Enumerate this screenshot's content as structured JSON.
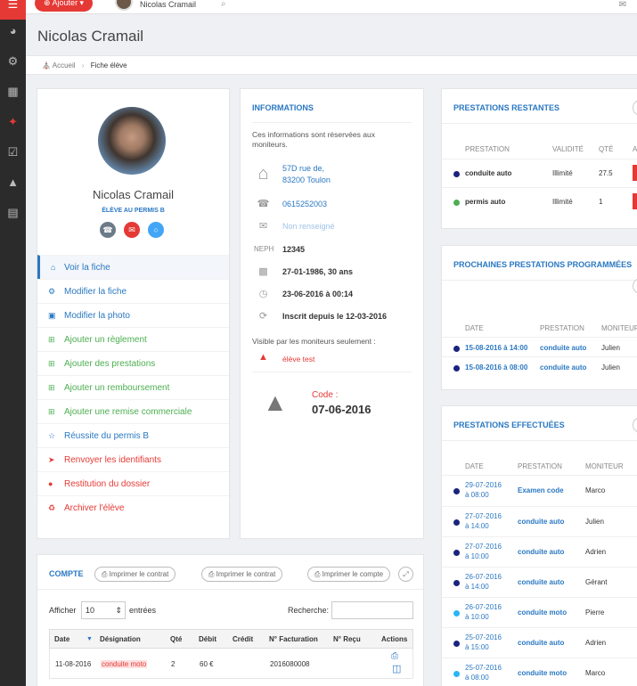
{
  "sidebar": {
    "icons": [
      "menu-icon",
      "dashboard-icon",
      "cogs-icon",
      "calendar-icon",
      "student-icon",
      "checklist-icon",
      "graduation-icon",
      "list-icon"
    ]
  },
  "topbar": {
    "add_label": "⊕ Ajouter ▾",
    "user_name": "Nicolas Cramail",
    "search_icon": "⌕",
    "mail_icon": "✉"
  },
  "page": {
    "title": "Nicolas Cramail"
  },
  "breadcrumb": {
    "home": "Accueil",
    "current": "Fiche élève",
    "sep": "›"
  },
  "profile": {
    "name": "Nicolas Cramail",
    "subtitle": "ÉLÈVE AU PERMIS B",
    "actions": [
      "phone",
      "mail",
      "chat"
    ]
  },
  "menu": [
    {
      "label": "Voir la fiche",
      "icon": "⌂",
      "color": "blue"
    },
    {
      "label": "Modifier la fiche",
      "icon": "⚙",
      "color": "blue"
    },
    {
      "label": "Modifier la photo",
      "icon": "▣",
      "color": "blue"
    },
    {
      "label": "Ajouter un règlement",
      "icon": "⊞",
      "color": "green"
    },
    {
      "label": "Ajouter des prestations",
      "icon": "⊞",
      "color": "green"
    },
    {
      "label": "Ajouter un remboursement",
      "icon": "⊞",
      "color": "green"
    },
    {
      "label": "Ajouter une remise commerciale",
      "icon": "⊞",
      "color": "green"
    },
    {
      "label": "Réussite du permis B",
      "icon": "☆",
      "color": "blue"
    },
    {
      "label": "Renvoyer les identifiants",
      "icon": "➤",
      "color": "red"
    },
    {
      "label": "Restitution du dossier",
      "icon": "●",
      "color": "red"
    },
    {
      "label": "Archiver l'élève",
      "icon": "♻",
      "color": "red"
    }
  ],
  "informations": {
    "title": "INFORMATIONS",
    "notice": "Ces informations sont réservées aux moniteurs.",
    "address_line1": "57D rue de,",
    "address_line2": "83200 Toulon",
    "phone": "0615252003",
    "email": "Non renseigné",
    "neph_label": "NEPH",
    "neph": "12345",
    "birth": "27-01-1986, 30 ans",
    "created": "23-06-2016 à 00:14",
    "registered": "Inscrit depuis le 12-03-2016",
    "visible_label": "Visible par les moniteurs seulement :",
    "alert": "élève test",
    "code_label": "Code :",
    "code_date": "07-06-2016"
  },
  "restantes": {
    "title": "PRESTATIONS RESTANTES",
    "headers": [
      "PRESTATION",
      "VALIDITÉ",
      "QTÉ",
      "A"
    ],
    "rows": [
      {
        "name": "conduite auto",
        "validity": "Illimité",
        "qty": "27.5",
        "color": "#1a237e"
      },
      {
        "name": "permis auto",
        "validity": "Illimité",
        "qty": "1",
        "color": "#4caf50"
      }
    ]
  },
  "prochaines": {
    "title": "PROCHAINES PRESTATIONS PROGRAMMÉES",
    "headers": [
      "DATE",
      "PRESTATION",
      "MONITEUR"
    ],
    "rows": [
      {
        "date": "15-08-2016 à 14:00",
        "prestation": "conduite auto",
        "moniteur": "Julien"
      },
      {
        "date": "15-08-2016 à 08:00",
        "prestation": "conduite auto",
        "moniteur": "Julien"
      }
    ]
  },
  "effectuees": {
    "title": "PRESTATIONS EFFECTUÉES",
    "headers": [
      "DATE",
      "PRESTATION",
      "MONITEUR"
    ],
    "rows": [
      {
        "date1": "29-07-2016",
        "date2": "à 08:00",
        "prestation": "Examen code",
        "moniteur": "Marco",
        "color": "#1a237e"
      },
      {
        "date1": "27-07-2016",
        "date2": "à 14:00",
        "prestation": "conduite auto",
        "moniteur": "Julien",
        "color": "#1a237e"
      },
      {
        "date1": "27-07-2016",
        "date2": "à 10:00",
        "prestation": "conduite auto",
        "moniteur": "Adrien",
        "color": "#1a237e"
      },
      {
        "date1": "26-07-2016",
        "date2": "à 14:00",
        "prestation": "conduite auto",
        "moniteur": "Gérant",
        "color": "#1a237e"
      },
      {
        "date1": "26-07-2016",
        "date2": "à 10:00",
        "prestation": "conduite moto",
        "moniteur": "Pierre",
        "color": "#29b6f6"
      },
      {
        "date1": "25-07-2016",
        "date2": "à 15:00",
        "prestation": "conduite auto",
        "moniteur": "Adrien",
        "color": "#1a237e"
      },
      {
        "date1": "25-07-2016",
        "date2": "à 08:00",
        "prestation": "conduite moto",
        "moniteur": "Marco",
        "color": "#29b6f6"
      }
    ]
  },
  "compte": {
    "title": "COMPTE",
    "btn_contrat1": "⎙ Imprimer le contrat",
    "btn_contrat2": "⎙ Imprimer le contrat",
    "btn_compte": "⎙ Imprimer le compte",
    "afficher": "Afficher",
    "entries_value": "10",
    "entrees": "entrées",
    "recherche": "Recherche:",
    "headers": [
      "Date",
      "Désignation",
      "Qté",
      "Débit",
      "Crédit",
      "N° Facturation",
      "N° Reçu",
      "Actions"
    ],
    "rows": [
      {
        "date": "11-08-2016",
        "designation": "conduite moto",
        "qty": "2",
        "debit": "60 €",
        "credit": "",
        "facturation": "2016080008",
        "recu": ""
      }
    ]
  }
}
